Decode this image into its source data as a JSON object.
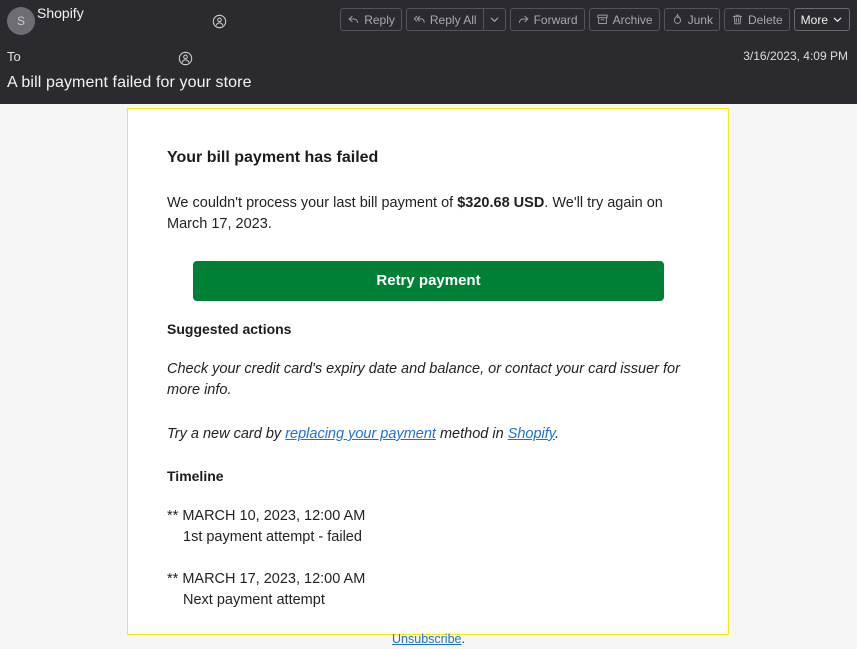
{
  "header": {
    "sender": {
      "avatar_initial": "S",
      "name": "Shopify",
      "contact_icon": "contact-circle-icon"
    },
    "to_label": "To",
    "to_contact_icon": "contact-circle-icon",
    "date": "3/16/2023, 4:09 PM",
    "subject": "A bill payment failed for your store",
    "background_color": "#2b2a2e"
  },
  "toolbar": {
    "reply_label": "Reply",
    "reply_icon": "reply-arrow-icon",
    "reply_all_label": "Reply All",
    "reply_all_icon": "reply-all-arrow-icon",
    "reply_all_caret_icon": "chevron-down-icon",
    "forward_label": "Forward",
    "forward_icon": "forward-arrow-icon",
    "archive_label": "Archive",
    "archive_icon": "archive-box-icon",
    "junk_label": "Junk",
    "junk_icon": "junk-flame-icon",
    "delete_label": "Delete",
    "delete_icon": "trash-icon",
    "more_label": "More",
    "more_caret_icon": "chevron-down-icon"
  },
  "email": {
    "border_color": "#f7ec0a",
    "heading": "Your bill payment has failed",
    "intro": {
      "before_amount": "We couldn't process your last bill payment of ",
      "amount": "$320.68 USD",
      "after_amount": ". We'll try again on March 17, 2023."
    },
    "cta": {
      "label": "Retry payment",
      "color": "#008037"
    },
    "suggested_actions": {
      "heading": "Suggested actions",
      "tip_1": "Check your credit card's expiry date and balance, or contact your card issuer for more info.",
      "tip_2": {
        "part_1": "Try a new card by ",
        "link_1": "replacing your payment",
        "part_2": " method in ",
        "link_2": "Shopify",
        "part_3": "."
      }
    },
    "timeline": {
      "heading": "Timeline",
      "entries": [
        {
          "date": "** MARCH 10, 2023, 12:00 AM",
          "description": "1st payment attempt - failed"
        },
        {
          "date": "** MARCH 17, 2023, 12:00 AM",
          "description": "Next payment attempt"
        }
      ]
    },
    "footer": {
      "unsubscribe_label": "Unsubscribe",
      "trailing_period": "."
    }
  }
}
